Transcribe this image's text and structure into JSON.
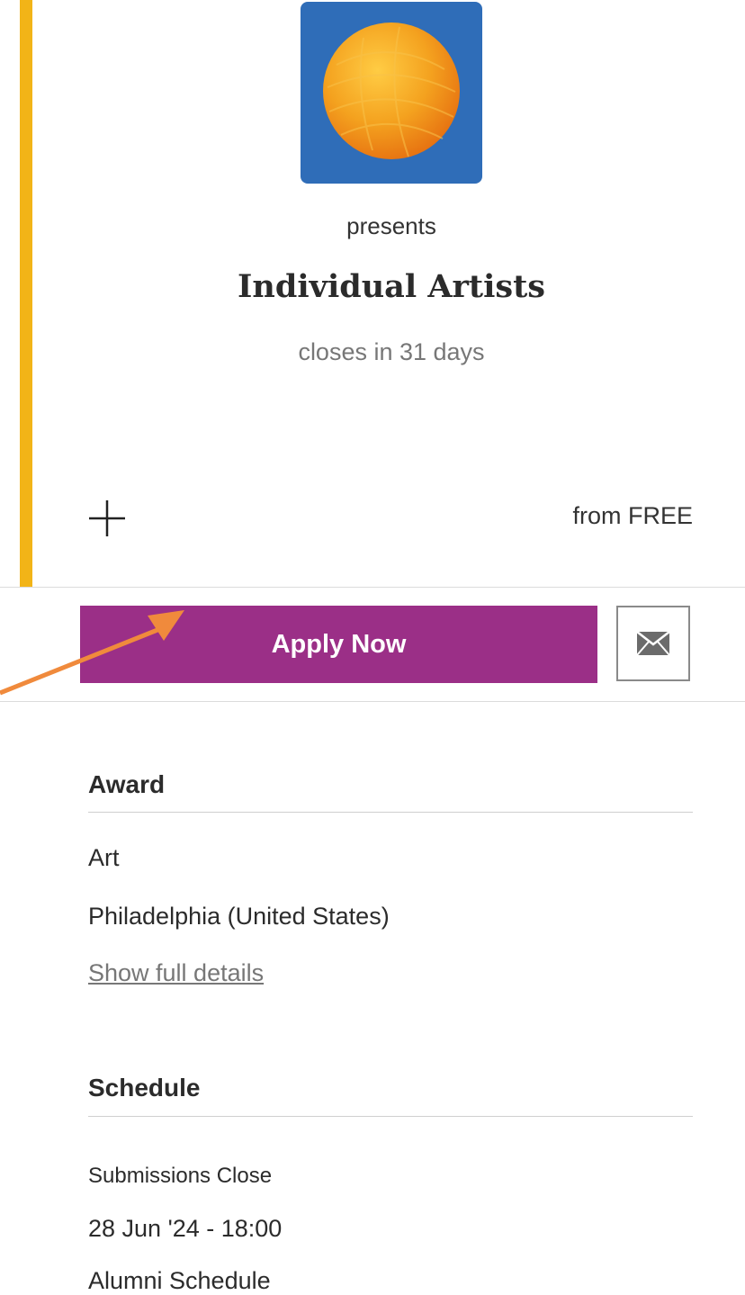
{
  "header": {
    "logo_icon": "orange-globe-logo",
    "presents": "presents",
    "title": "Individual Artists",
    "closes": "closes in 31 days"
  },
  "card": {
    "add_icon": "plus-icon",
    "price": "from FREE"
  },
  "actions": {
    "apply_label": "Apply Now",
    "mail_icon": "envelope-icon"
  },
  "award": {
    "heading": "Award",
    "category": "Art",
    "location": "Philadelphia (United States)",
    "details_link": "Show full details"
  },
  "schedule": {
    "heading": "Schedule",
    "label": "Submissions Close",
    "value": "28 Jun '24 - 18:00",
    "next_label_partial": "Alumni Schedule"
  },
  "colors": {
    "accent": "#f2b417",
    "apply_button": "#9b2f87",
    "logo_bg": "#2f6db8",
    "logo_globe": "#f29a1a",
    "arrow": "#f08a3c"
  }
}
